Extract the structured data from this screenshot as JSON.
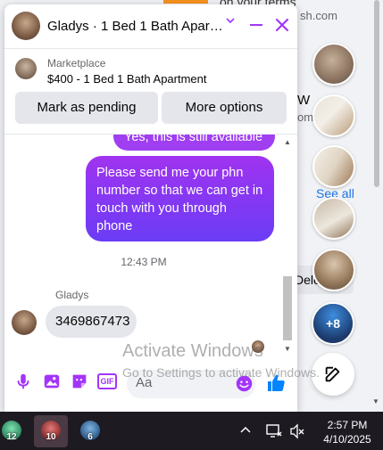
{
  "background": {
    "text_top": "on your terms",
    "text_domain": "sh.com",
    "fragment_w": "W",
    "fragment_om": "om",
    "see_all": "See all",
    "delete_frag": "Dele",
    "more_count": "+8"
  },
  "chat": {
    "title": "Gladys · 1 Bed 1 Bath Apart…",
    "marketplace_label": "Marketplace",
    "listing_title": "$400 - 1 Bed 1 Bath Apartment",
    "mark_pending_label": "Mark as pending",
    "more_options_label": "More options",
    "messages": {
      "outgoing_1": "Yes, this is still available",
      "outgoing_2": "Please send me your phn number so that we can get in touch with you through phone",
      "timestamp": "12:43 PM",
      "sender_name": "Gladys",
      "incoming_1": "3469867473"
    },
    "composer": {
      "placeholder": "Aa",
      "gif_label": "GIF"
    }
  },
  "watermark": {
    "line1": "Activate Windows",
    "line2": "Go to Settings to activate Windows."
  },
  "taskbar": {
    "apps": [
      {
        "badge": "12"
      },
      {
        "badge": "10"
      },
      {
        "badge": "6"
      }
    ],
    "time": "2:57 PM",
    "date": "4/10/2025"
  },
  "colors": {
    "messenger_purple": "#a334fa",
    "outgoing_gradient_top": "#a033f0",
    "outgoing_gradient_bottom": "#6b3cf5",
    "like_blue": "#0084ff"
  }
}
